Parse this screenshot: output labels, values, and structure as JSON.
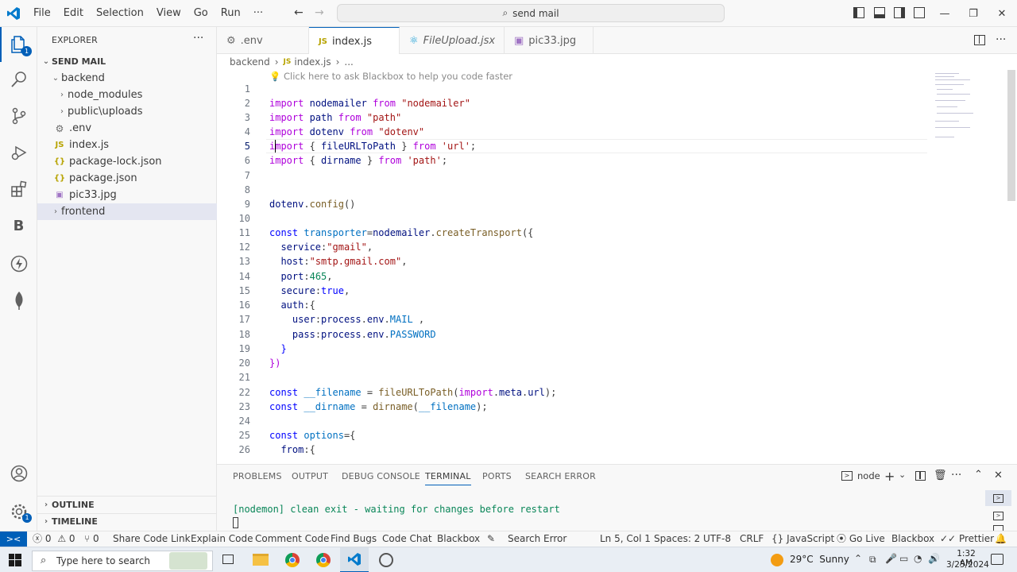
{
  "titlebar": {
    "menus": [
      "File",
      "Edit",
      "Selection",
      "View",
      "Go",
      "Run",
      "···"
    ],
    "search": "send mail"
  },
  "activity": {
    "badge": "1"
  },
  "explorer": {
    "title": "EXPLORER",
    "root": "SEND MAIL",
    "tree": [
      {
        "label": "backend",
        "type": "folder-open",
        "indent": 1
      },
      {
        "label": "node_modules",
        "type": "folder",
        "indent": 2
      },
      {
        "label": "public\\uploads",
        "type": "folder",
        "indent": 2
      },
      {
        "label": ".env",
        "type": "env",
        "indent": 2
      },
      {
        "label": "index.js",
        "type": "js",
        "indent": 2
      },
      {
        "label": "package-lock.json",
        "type": "json",
        "indent": 2
      },
      {
        "label": "package.json",
        "type": "json",
        "indent": 2
      },
      {
        "label": "pic33.jpg",
        "type": "img",
        "indent": 2
      },
      {
        "label": "frontend",
        "type": "folder",
        "indent": 1
      }
    ],
    "outline": "OUTLINE",
    "timeline": "TIMELINE"
  },
  "tabs": [
    {
      "label": ".env",
      "icon": "gear-icon"
    },
    {
      "label": "index.js",
      "icon": "js-icon"
    },
    {
      "label": "FileUpload.jsx",
      "icon": "react-icon"
    },
    {
      "label": "pic33.jpg",
      "icon": "image-icon"
    }
  ],
  "breadcrumb": {
    "folder": "backend",
    "file": "index.js",
    "rest": "..."
  },
  "editor": {
    "hint": "Click here to ask Blackbox to help you code faster",
    "line_numbers": [
      "1",
      "2",
      "3",
      "4",
      "5",
      "6",
      "7",
      "8",
      "9",
      "10",
      "11",
      "12",
      "13",
      "14",
      "15",
      "16",
      "17",
      "18",
      "19",
      "20",
      "21",
      "22",
      "23",
      "24",
      "25",
      "26"
    ],
    "current_line": 5
  },
  "panel": {
    "tabs": [
      "PROBLEMS",
      "OUTPUT",
      "DEBUG CONSOLE",
      "TERMINAL",
      "PORTS",
      "SEARCH ERROR"
    ],
    "active_tab": "TERMINAL",
    "shell": "node",
    "terminal_line": "[nodemon] clean exit - waiting for changes before restart"
  },
  "statusbar": {
    "errors": "0",
    "warnings": "0",
    "info": "0",
    "items_left": [
      "Share Code Link",
      "Explain Code",
      "Comment Code",
      "Find Bugs",
      "Code Chat",
      "Blackbox",
      "Search Error"
    ],
    "position": "Ln 5, Col 1",
    "spaces": "Spaces: 2",
    "encoding": "UTF-8",
    "eol": "CRLF",
    "language": "JavaScript",
    "golive": "Go Live",
    "blackbox": "Blackbox",
    "prettier": "Prettier"
  },
  "taskbar": {
    "search_placeholder": "Type here to search",
    "weather": "29°C  Sunny",
    "time": "1:32 AM",
    "date": "3/25/2024"
  },
  "colors": {
    "accent": "#005fb8",
    "keyword": "#0000ff",
    "string": "#a31515"
  }
}
